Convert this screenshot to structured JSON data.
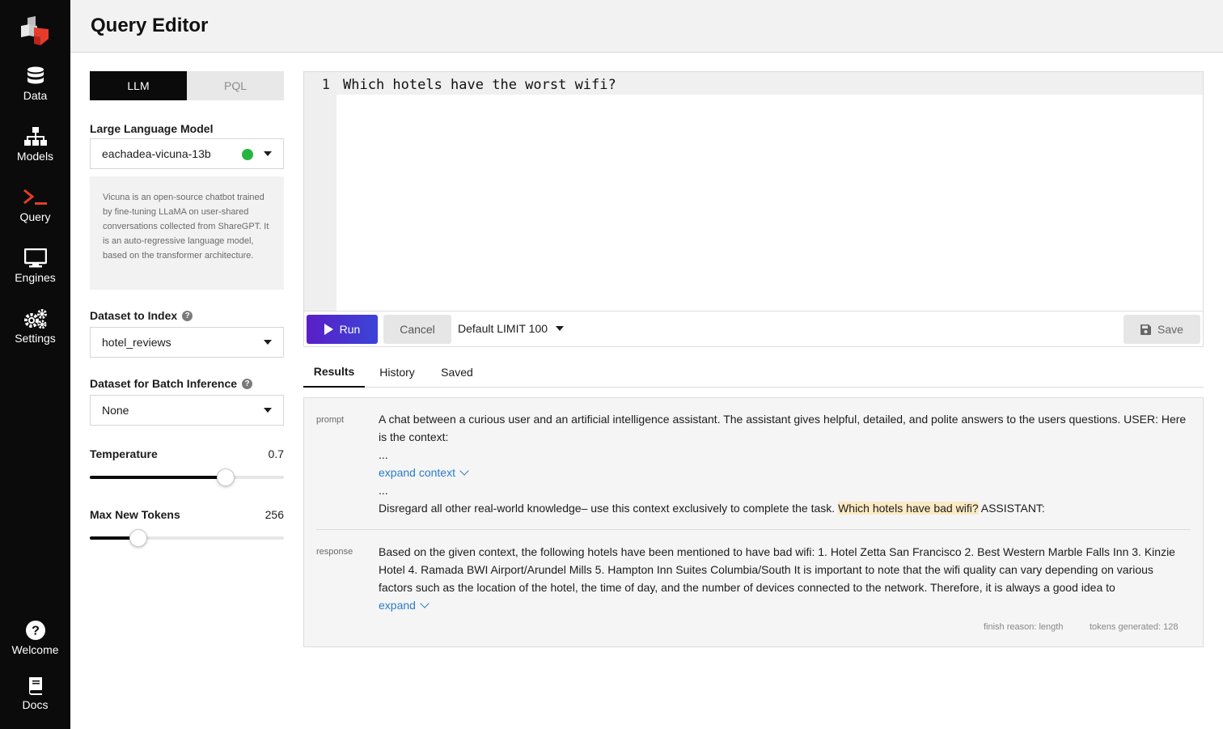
{
  "sidebar": {
    "items": [
      {
        "label": "Data",
        "icon": "database-icon"
      },
      {
        "label": "Models",
        "icon": "hierarchy-icon"
      },
      {
        "label": "Query",
        "icon": "terminal-icon"
      },
      {
        "label": "Engines",
        "icon": "monitor-icon"
      },
      {
        "label": "Settings",
        "icon": "gears-icon"
      }
    ],
    "bottom": [
      {
        "label": "Welcome",
        "icon": "help-circle-icon"
      },
      {
        "label": "Docs",
        "icon": "book-icon"
      }
    ],
    "active": "Query"
  },
  "header": {
    "title": "Query Editor"
  },
  "mode_toggle": {
    "options": [
      "LLM",
      "PQL"
    ],
    "active": "LLM"
  },
  "llm": {
    "label": "Large Language Model",
    "value": "eachadea-vicuna-13b",
    "status_color": "#26b540",
    "description": "Vicuna is an open-source chatbot trained by fine-tuning LLaMA on user-shared conversations collected from ShareGPT. It is an auto-regressive language model, based on the transformer architecture."
  },
  "dataset_index": {
    "label": "Dataset to Index",
    "value": "hotel_reviews"
  },
  "dataset_batch": {
    "label": "Dataset for Batch Inference",
    "value": "None"
  },
  "temperature": {
    "label": "Temperature",
    "value": "0.7",
    "fraction": 0.7
  },
  "max_tokens": {
    "label": "Max New Tokens",
    "value": "256",
    "fraction": 0.25
  },
  "editor": {
    "line_number": "1",
    "code": "Which hotels have the worst wifi?"
  },
  "toolbar": {
    "run_label": "Run",
    "cancel_label": "Cancel",
    "limit_label": "Default LIMIT 100",
    "save_label": "Save"
  },
  "tabs": [
    {
      "label": "Results"
    },
    {
      "label": "History"
    },
    {
      "label": "Saved"
    }
  ],
  "active_tab": "Results",
  "result": {
    "prompt_label": "prompt",
    "prompt_intro": "A chat between a curious user and an artificial intelligence assistant. The assistant gives helpful, detailed, and polite answers to the users questions. USER: Here is the context:",
    "ellipsis": "...",
    "expand_context": "expand context",
    "prompt_before": "Disregard all other real-world knowledge– use this context exclusively to complete the task.",
    "prompt_question": "Which hotels have bad wifi?",
    "prompt_after": "ASSISTANT:",
    "response_label": "response",
    "response_text": "Based on the given context, the following hotels have been mentioned to have bad wifi: 1. Hotel Zetta San Francisco 2. Best Western Marble Falls Inn 3. Kinzie Hotel 4. Ramada BWI Airport/Arundel Mills 5. Hampton Inn Suites Columbia/South It is important to note that the wifi quality can vary depending on various factors such as the location of the hotel, the time of day, and the number of devices connected to the network. Therefore, it is always a good idea to",
    "expand": "expand",
    "finish_reason": "finish reason: length",
    "tokens_generated": "tokens generated: 128"
  }
}
